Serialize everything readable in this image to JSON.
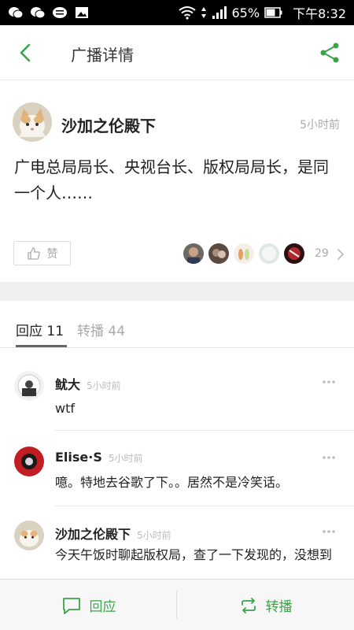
{
  "status_bar": {
    "battery": "65%",
    "time": "下午8:32"
  },
  "header": {
    "title": "广播详情"
  },
  "post": {
    "author": "沙加之伦殿下",
    "time": "5小时前",
    "text": "广电总局局长、央视台长、版权局局长，是同一个人……",
    "like_label": "赞",
    "like_count": "29"
  },
  "tabs": {
    "replies": "回应 11",
    "reposts": "转播 44"
  },
  "comments": [
    {
      "author": "鱿大",
      "time": "5小时前",
      "text": "wtf"
    },
    {
      "author": "Elise·S",
      "time": "5小时前",
      "text": "噫。特地去谷歌了下。。居然不是冷笑话。"
    },
    {
      "author": "沙加之伦殿下",
      "time": "5小时前",
      "text": "今天午饭时聊起版权局，查了一下发现的，没想到"
    }
  ],
  "bottom_bar": {
    "reply_label": "回应",
    "repost_label": "转播"
  },
  "colors": {
    "accent": "#3ba34a",
    "muted": "#aaaaaa"
  }
}
